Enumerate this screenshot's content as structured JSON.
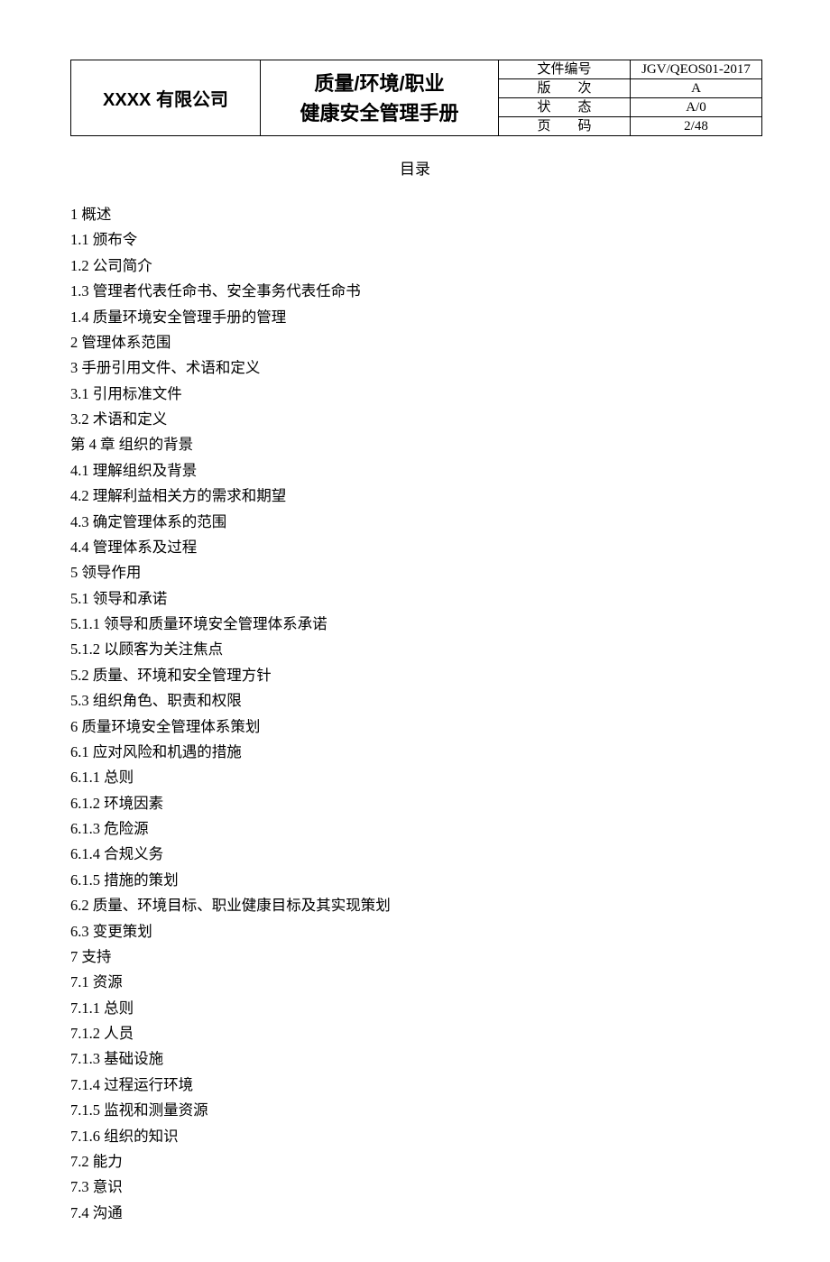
{
  "header": {
    "company": "XXXX 有限公司",
    "title_line1": "质量/环境/职业",
    "title_line2": "健康安全管理手册",
    "meta": {
      "label1": "文件编号",
      "value1": "JGV/QEOS01-2017",
      "label2": "版　　次",
      "value2": "A",
      "label3": "状　　态",
      "value3": "A/0",
      "label4": "页　　码",
      "value4": "2/48"
    }
  },
  "toc_title": "目录",
  "toc": [
    {
      "n": "1",
      "t": "概述"
    },
    {
      "n": "1.1",
      "t": "颁布令"
    },
    {
      "n": "1.2",
      "t": "公司简介"
    },
    {
      "n": "1.3",
      "t": "管理者代表任命书、安全事务代表任命书"
    },
    {
      "n": "1.4",
      "t": "质量环境安全管理手册的管理"
    },
    {
      "n": "2",
      "t": "管理体系范围"
    },
    {
      "n": "3",
      "t": "手册引用文件、术语和定义"
    },
    {
      "n": "3.1",
      "t": "引用标准文件"
    },
    {
      "n": "3.2",
      "t": "术语和定义"
    },
    {
      "n": "第 4 章",
      "t": "组织的背景"
    },
    {
      "n": "4.1",
      "t": "理解组织及背景"
    },
    {
      "n": "4.2",
      "t": "理解利益相关方的需求和期望"
    },
    {
      "n": "4.3",
      "t": "确定管理体系的范围"
    },
    {
      "n": "4.4",
      "t": "管理体系及过程"
    },
    {
      "n": "5",
      "t": "领导作用"
    },
    {
      "n": "5.1",
      "t": "领导和承诺"
    },
    {
      "n": "5.1.1",
      "t": "领导和质量环境安全管理体系承诺"
    },
    {
      "n": "5.1.2",
      "t": "以顾客为关注焦点"
    },
    {
      "n": "5.2",
      "t": "质量、环境和安全管理方针"
    },
    {
      "n": "5.3",
      "t": "组织角色、职责和权限"
    },
    {
      "n": "6",
      "t": "质量环境安全管理体系策划"
    },
    {
      "n": "6.1",
      "t": "应对风险和机遇的措施"
    },
    {
      "n": "6.1.1",
      "t": "总则"
    },
    {
      "n": "6.1.2",
      "t": "环境因素"
    },
    {
      "n": "6.1.3",
      "t": "危险源"
    },
    {
      "n": "6.1.4",
      "t": "合规义务"
    },
    {
      "n": "6.1.5",
      "t": "措施的策划"
    },
    {
      "n": "6.2",
      "t": "质量、环境目标、职业健康目标及其实现策划"
    },
    {
      "n": "6.3",
      "t": "变更策划"
    },
    {
      "n": "7",
      "t": "支持"
    },
    {
      "n": "7.1",
      "t": "资源"
    },
    {
      "n": "7.1.1",
      "t": "总则"
    },
    {
      "n": "7.1.2",
      "t": "人员"
    },
    {
      "n": "7.1.3",
      "t": "基础设施"
    },
    {
      "n": "7.1.4",
      "t": "过程运行环境"
    },
    {
      "n": "7.1.5",
      "t": "监视和测量资源"
    },
    {
      "n": "7.1.6",
      "t": "组织的知识"
    },
    {
      "n": "7.2",
      "t": "能力"
    },
    {
      "n": "7.3",
      "t": "意识"
    },
    {
      "n": "7.4",
      "t": "沟通"
    }
  ]
}
